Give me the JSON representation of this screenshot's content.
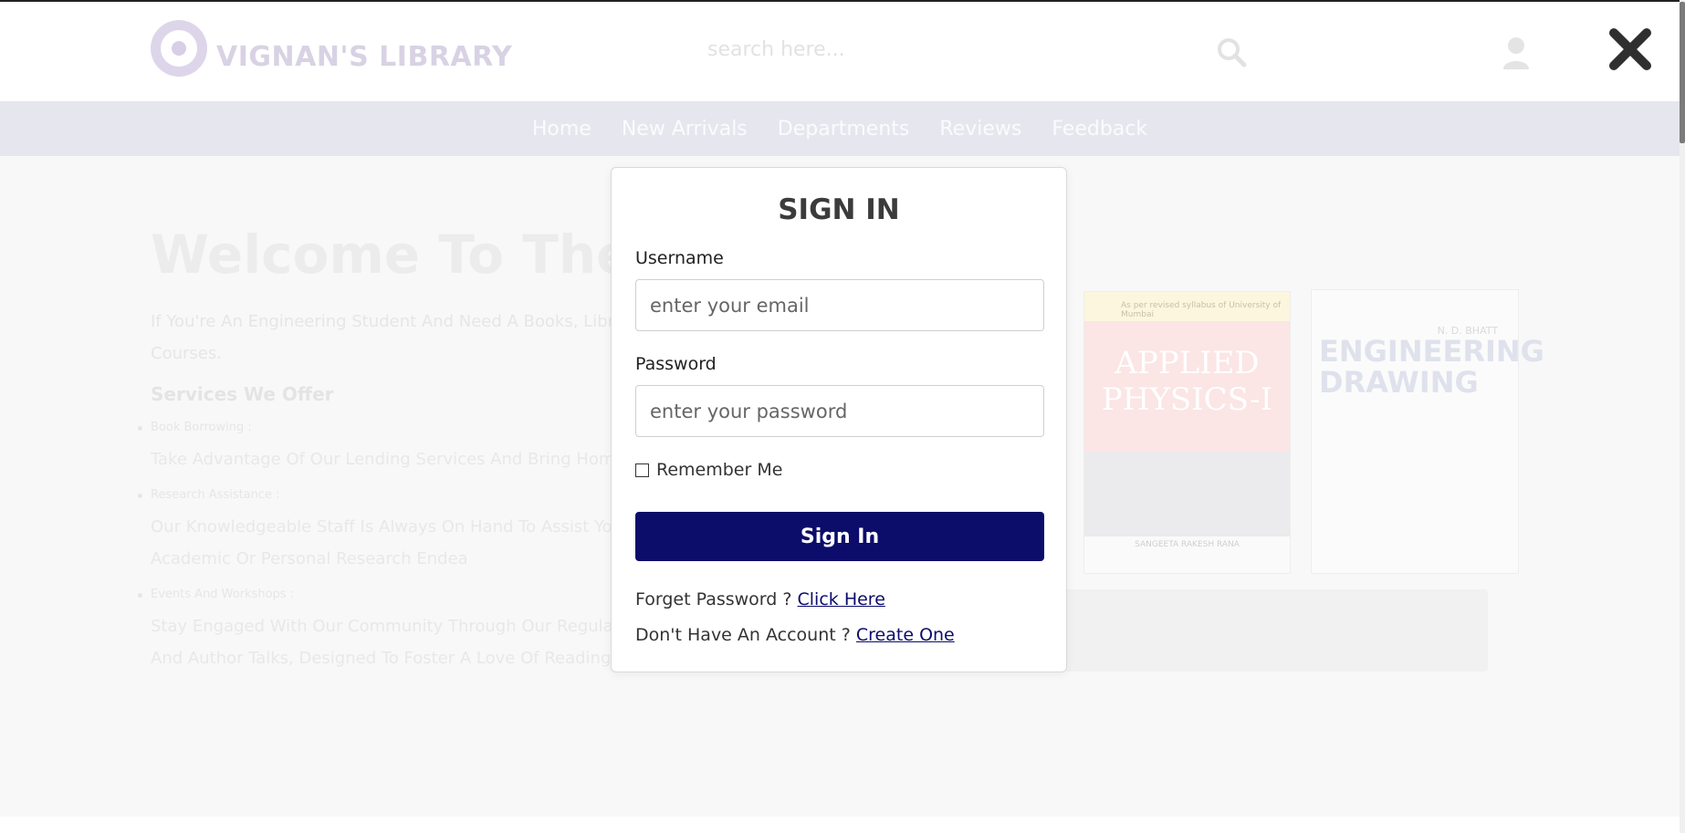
{
  "header": {
    "logo_text": "VIGNAN'S LIBRARY",
    "search_placeholder": "search here...",
    "icons": {
      "search": "search-icon",
      "user": "user-icon",
      "close": "close-icon"
    }
  },
  "nav": {
    "items": [
      {
        "label": "Home"
      },
      {
        "label": "New Arrivals"
      },
      {
        "label": "Departments"
      },
      {
        "label": "Reviews"
      },
      {
        "label": "Feedback"
      }
    ]
  },
  "hero": {
    "title": "Welcome To The L",
    "intro": "If You're An Engineering Student And Need A Books, Library For Different Courses.",
    "services_heading": "Services We Offer",
    "services": [
      {
        "title": "Book Borrowing :",
        "desc": "Take Advantage Of Our Lending Services And Bring Home At Your Leisure."
      },
      {
        "title": "Research Assistance :",
        "desc": "Our Knowledgeable Staff Is Always On Hand To Assist You You Need For Your Academic Or Personal Research Endea"
      },
      {
        "title": "Events And Workshops :",
        "desc": "Stay Engaged With Our Community Through Our Regular Events, Workshops, And Author Talks, Designed To Foster A Love Of Reading And Lifelong Learning."
      }
    ]
  },
  "books": [
    {
      "top_band": "As per revised syllabus of University of Mumbai",
      "title_line1": "APPLIED",
      "title_line2": "PHYSICS-I",
      "author": "SANGEETA RAKESH RANA"
    },
    {
      "author": "N. D. BHATT",
      "title_line1": "ENGINEERING",
      "title_line2": "DRAWING"
    }
  ],
  "modal": {
    "title": "SIGN IN",
    "username_label": "Username",
    "username_placeholder": "enter your email",
    "password_label": "Password",
    "password_placeholder": "enter your password",
    "remember_label": "Remember Me",
    "submit_label": "Sign In",
    "forgot_text": "Forget Password ?",
    "forgot_link": "Click Here",
    "create_text": "Don't Have An Account ?",
    "create_link": "Create One"
  },
  "colors": {
    "primary_button": "#0c0c6b",
    "navbar_bg": "#e6e6ee"
  }
}
